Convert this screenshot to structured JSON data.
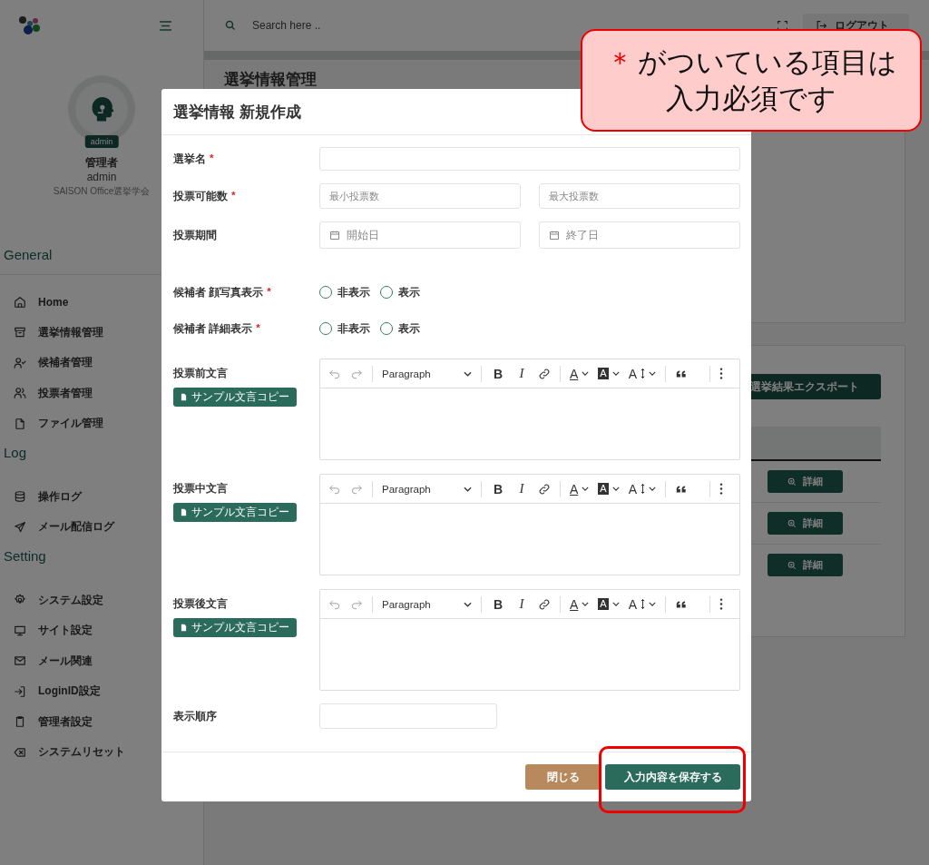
{
  "sidebar": {
    "user": {
      "badge": "admin",
      "role_name": "管理者",
      "username": "admin",
      "org": "SAISON Office選挙学会"
    },
    "sections": [
      {
        "title": "General",
        "items": [
          {
            "label": "Home"
          },
          {
            "label": "選挙情報管理"
          },
          {
            "label": "候補者管理"
          },
          {
            "label": "投票者管理"
          },
          {
            "label": "ファイル管理"
          }
        ]
      },
      {
        "title": "Log",
        "items": [
          {
            "label": "操作ログ"
          },
          {
            "label": "メール配信ログ"
          }
        ]
      },
      {
        "title": "Setting",
        "items": [
          {
            "label": "システム設定"
          },
          {
            "label": "サイト設定"
          },
          {
            "label": "メール関連"
          },
          {
            "label": "LoginID設定"
          },
          {
            "label": "管理者設定"
          },
          {
            "label": "システムリセット"
          }
        ]
      }
    ]
  },
  "header": {
    "search": {
      "placeholder": "Search here .."
    },
    "logout_button": "ログアウト"
  },
  "page": {
    "title": "選挙情報管理",
    "export_button": "選挙結果エクスポート",
    "detail_buttons": [
      "詳細",
      "詳細",
      "詳細"
    ]
  },
  "modal": {
    "title": "選挙情報 新規作成",
    "name_field": {
      "label": "選挙名",
      "required_mark": "*"
    },
    "vote_count": {
      "label": "投票可能数",
      "required_mark": "*",
      "min_placeholder": "最小投票数",
      "max_placeholder": "最大投票数"
    },
    "period": {
      "label": "投票期間",
      "start_placeholder": "開始日",
      "end_placeholder": "終了日"
    },
    "radio_groups": [
      {
        "label": "候補者 顔写真表示",
        "required_mark": "*",
        "options": [
          {
            "label": "非表示",
            "selected": false
          },
          {
            "label": "表示",
            "selected": false
          }
        ]
      },
      {
        "label": "候補者 詳細表示",
        "required_mark": "*",
        "options": [
          {
            "label": "非表示",
            "selected": false
          },
          {
            "label": "表示",
            "selected": false
          }
        ]
      }
    ],
    "editors": [
      {
        "label": "投票前文言",
        "copy_button": "サンプル文言コピー",
        "toolbar": {
          "format": "Paragraph",
          "bold": "B",
          "italic": "I",
          "font_color": "A",
          "highlight": "A",
          "font_size": "A"
        }
      },
      {
        "label": "投票中文言",
        "copy_button": "サンプル文言コピー",
        "toolbar": {
          "format": "Paragraph",
          "bold": "B",
          "italic": "I",
          "font_color": "A",
          "highlight": "A",
          "font_size": "A"
        }
      },
      {
        "label": "投票後文言",
        "copy_button": "サンプル文言コピー",
        "toolbar": {
          "format": "Paragraph",
          "bold": "B",
          "italic": "I",
          "font_color": "A",
          "highlight": "A",
          "font_size": "A"
        }
      }
    ],
    "order_field": {
      "label": "表示順序"
    },
    "buttons": [
      {
        "label": "閉じる",
        "kind": "secondary"
      },
      {
        "label": "入力内容を保存する",
        "kind": "primary"
      }
    ]
  },
  "callout": {
    "mark": "＊",
    "lines": [
      "がついている項目は",
      "入力必須です"
    ]
  }
}
